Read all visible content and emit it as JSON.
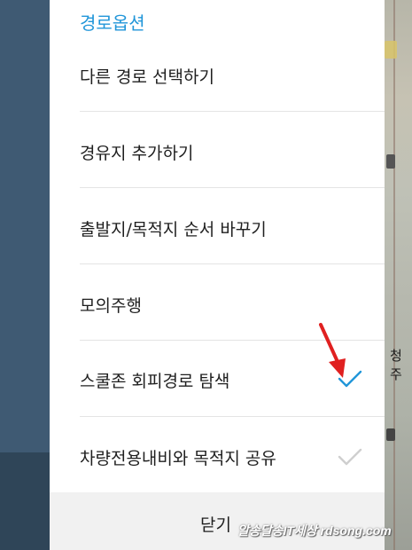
{
  "dialog": {
    "title": "경로옵션",
    "options": [
      {
        "label": "다른 경로 선택하기"
      },
      {
        "label": "경유지 추가하기"
      },
      {
        "label": "출발지/목적지 순서 바꾸기"
      },
      {
        "label": "모의주행"
      },
      {
        "label": "스쿨존 회피경로 탐색",
        "checked": true,
        "check_color": "#2196d9"
      },
      {
        "label": "차량전용내비와 목적지 공유",
        "checked": false,
        "check_color": "#cfcfcf"
      }
    ],
    "close_label": "닫기"
  },
  "map": {
    "place_label": "청주"
  },
  "watermark": "알송달송IT세상 rdsong.com",
  "colors": {
    "accent": "#2196d9",
    "annotation_arrow": "#e02020"
  }
}
